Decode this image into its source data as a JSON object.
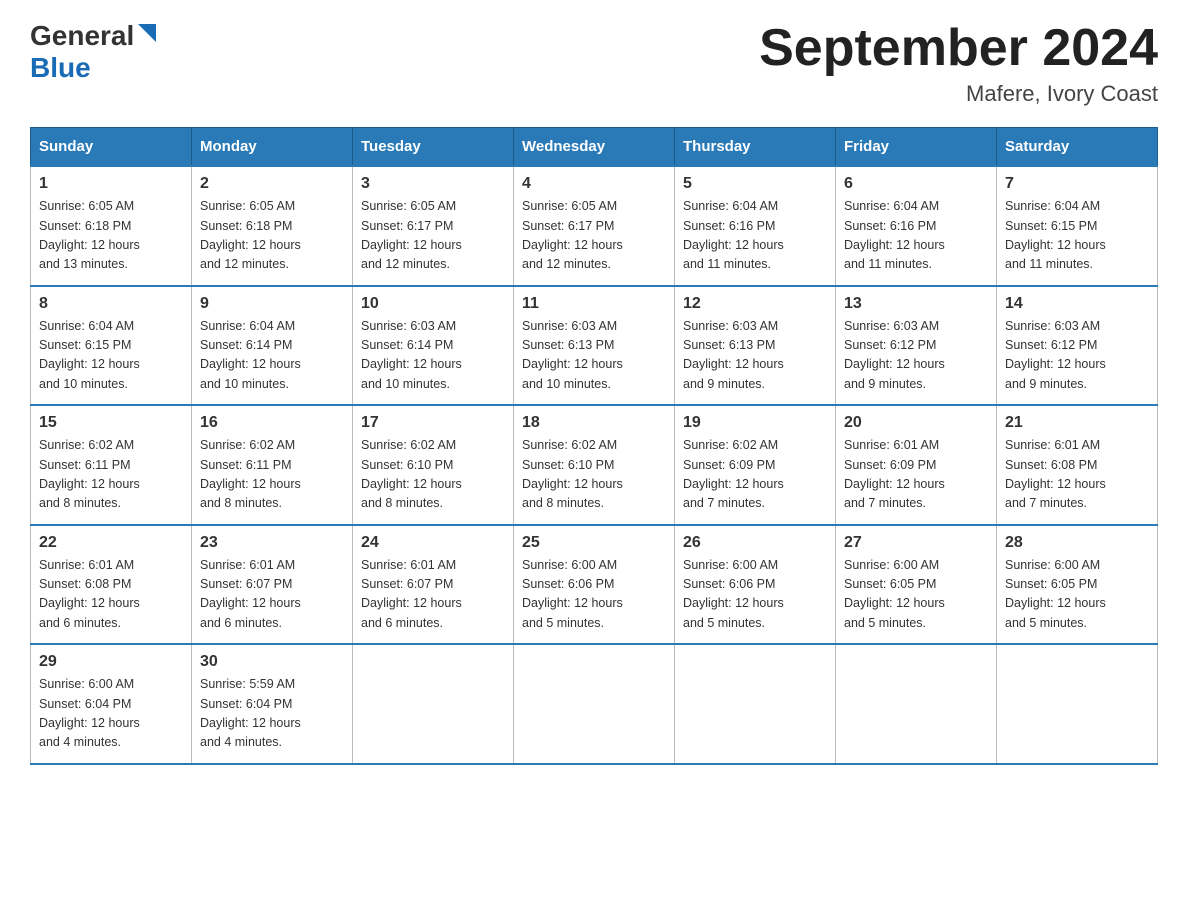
{
  "header": {
    "logo_general": "General",
    "logo_blue": "Blue",
    "month_title": "September 2024",
    "location": "Mafere, Ivory Coast"
  },
  "days_of_week": [
    "Sunday",
    "Monday",
    "Tuesday",
    "Wednesday",
    "Thursday",
    "Friday",
    "Saturday"
  ],
  "weeks": [
    [
      {
        "day": "1",
        "sunrise": "6:05 AM",
        "sunset": "6:18 PM",
        "daylight": "12 hours and 13 minutes."
      },
      {
        "day": "2",
        "sunrise": "6:05 AM",
        "sunset": "6:18 PM",
        "daylight": "12 hours and 12 minutes."
      },
      {
        "day": "3",
        "sunrise": "6:05 AM",
        "sunset": "6:17 PM",
        "daylight": "12 hours and 12 minutes."
      },
      {
        "day": "4",
        "sunrise": "6:05 AM",
        "sunset": "6:17 PM",
        "daylight": "12 hours and 12 minutes."
      },
      {
        "day": "5",
        "sunrise": "6:04 AM",
        "sunset": "6:16 PM",
        "daylight": "12 hours and 11 minutes."
      },
      {
        "day": "6",
        "sunrise": "6:04 AM",
        "sunset": "6:16 PM",
        "daylight": "12 hours and 11 minutes."
      },
      {
        "day": "7",
        "sunrise": "6:04 AM",
        "sunset": "6:15 PM",
        "daylight": "12 hours and 11 minutes."
      }
    ],
    [
      {
        "day": "8",
        "sunrise": "6:04 AM",
        "sunset": "6:15 PM",
        "daylight": "12 hours and 10 minutes."
      },
      {
        "day": "9",
        "sunrise": "6:04 AM",
        "sunset": "6:14 PM",
        "daylight": "12 hours and 10 minutes."
      },
      {
        "day": "10",
        "sunrise": "6:03 AM",
        "sunset": "6:14 PM",
        "daylight": "12 hours and 10 minutes."
      },
      {
        "day": "11",
        "sunrise": "6:03 AM",
        "sunset": "6:13 PM",
        "daylight": "12 hours and 10 minutes."
      },
      {
        "day": "12",
        "sunrise": "6:03 AM",
        "sunset": "6:13 PM",
        "daylight": "12 hours and 9 minutes."
      },
      {
        "day": "13",
        "sunrise": "6:03 AM",
        "sunset": "6:12 PM",
        "daylight": "12 hours and 9 minutes."
      },
      {
        "day": "14",
        "sunrise": "6:03 AM",
        "sunset": "6:12 PM",
        "daylight": "12 hours and 9 minutes."
      }
    ],
    [
      {
        "day": "15",
        "sunrise": "6:02 AM",
        "sunset": "6:11 PM",
        "daylight": "12 hours and 8 minutes."
      },
      {
        "day": "16",
        "sunrise": "6:02 AM",
        "sunset": "6:11 PM",
        "daylight": "12 hours and 8 minutes."
      },
      {
        "day": "17",
        "sunrise": "6:02 AM",
        "sunset": "6:10 PM",
        "daylight": "12 hours and 8 minutes."
      },
      {
        "day": "18",
        "sunrise": "6:02 AM",
        "sunset": "6:10 PM",
        "daylight": "12 hours and 8 minutes."
      },
      {
        "day": "19",
        "sunrise": "6:02 AM",
        "sunset": "6:09 PM",
        "daylight": "12 hours and 7 minutes."
      },
      {
        "day": "20",
        "sunrise": "6:01 AM",
        "sunset": "6:09 PM",
        "daylight": "12 hours and 7 minutes."
      },
      {
        "day": "21",
        "sunrise": "6:01 AM",
        "sunset": "6:08 PM",
        "daylight": "12 hours and 7 minutes."
      }
    ],
    [
      {
        "day": "22",
        "sunrise": "6:01 AM",
        "sunset": "6:08 PM",
        "daylight": "12 hours and 6 minutes."
      },
      {
        "day": "23",
        "sunrise": "6:01 AM",
        "sunset": "6:07 PM",
        "daylight": "12 hours and 6 minutes."
      },
      {
        "day": "24",
        "sunrise": "6:01 AM",
        "sunset": "6:07 PM",
        "daylight": "12 hours and 6 minutes."
      },
      {
        "day": "25",
        "sunrise": "6:00 AM",
        "sunset": "6:06 PM",
        "daylight": "12 hours and 5 minutes."
      },
      {
        "day": "26",
        "sunrise": "6:00 AM",
        "sunset": "6:06 PM",
        "daylight": "12 hours and 5 minutes."
      },
      {
        "day": "27",
        "sunrise": "6:00 AM",
        "sunset": "6:05 PM",
        "daylight": "12 hours and 5 minutes."
      },
      {
        "day": "28",
        "sunrise": "6:00 AM",
        "sunset": "6:05 PM",
        "daylight": "12 hours and 5 minutes."
      }
    ],
    [
      {
        "day": "29",
        "sunrise": "6:00 AM",
        "sunset": "6:04 PM",
        "daylight": "12 hours and 4 minutes."
      },
      {
        "day": "30",
        "sunrise": "5:59 AM",
        "sunset": "6:04 PM",
        "daylight": "12 hours and 4 minutes."
      },
      null,
      null,
      null,
      null,
      null
    ]
  ],
  "labels": {
    "sunrise": "Sunrise:",
    "sunset": "Sunset:",
    "daylight": "Daylight:"
  }
}
